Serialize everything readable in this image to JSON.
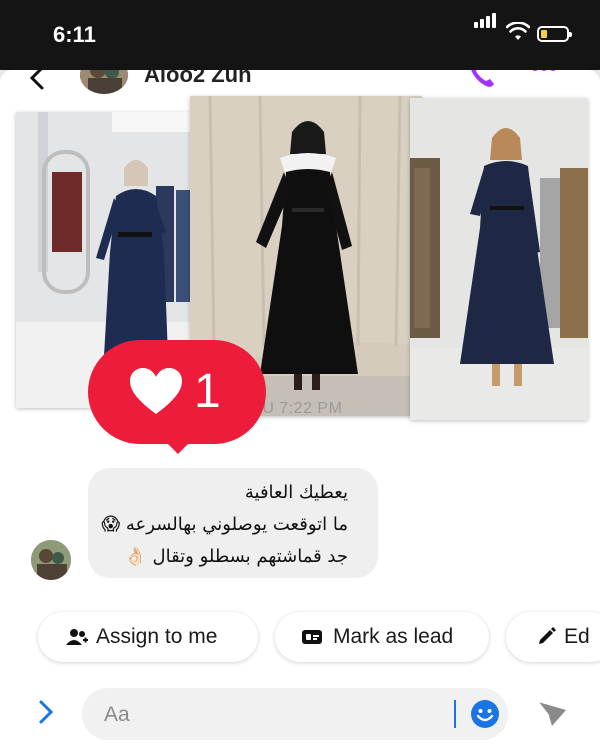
{
  "status_bar": {
    "time": "6:11"
  },
  "header": {
    "contact_name": "Aloo2 Zun"
  },
  "messages": {
    "timestamp": "THU 7:22 PM",
    "reaction": {
      "count": "1"
    },
    "text_lines": [
      "يعطيك العافية",
      "ما اتوقعت يوصلوني بهالسرعه 😱",
      "جد قماشتهم بسطلو وتقال 👌🏻"
    ]
  },
  "quick_actions": [
    {
      "label": "Assign to me",
      "icon": "assign-person-icon"
    },
    {
      "label": "Mark as lead",
      "icon": "lead-card-icon"
    },
    {
      "label": "Ed",
      "icon": "edit-pencil-icon"
    }
  ],
  "composer": {
    "placeholder": "Aa"
  },
  "colors": {
    "accent": "#1b74e4",
    "reaction": "#ec1c3a",
    "call": "#a033ff"
  }
}
